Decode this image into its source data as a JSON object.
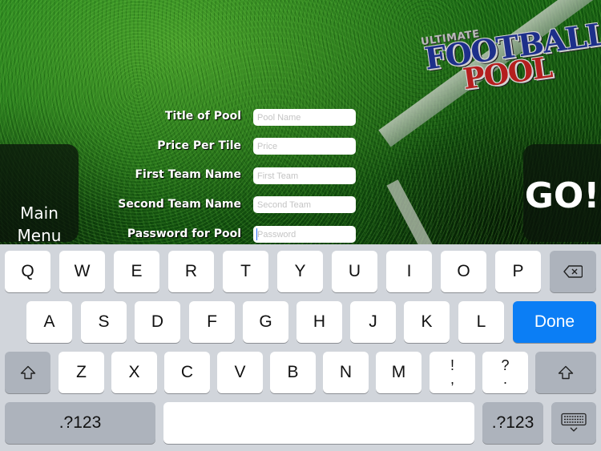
{
  "app": {
    "logo": {
      "line1": "ULTIMATE",
      "line2": "FOOTBALL",
      "line3": "POOL"
    },
    "main_menu_label": "Main\nMenu",
    "go_label": "GO!",
    "form": [
      {
        "label": "Title of Pool",
        "placeholder": "Pool Name",
        "value": ""
      },
      {
        "label": "Price Per Tile",
        "placeholder": "Price",
        "value": ""
      },
      {
        "label": "First Team Name",
        "placeholder": "First Team",
        "value": ""
      },
      {
        "label": "Second Team Name",
        "placeholder": "Second Team",
        "value": ""
      },
      {
        "label": "Password for Pool",
        "placeholder": "Password",
        "value": ""
      }
    ]
  },
  "keyboard": {
    "row1": [
      "Q",
      "W",
      "E",
      "R",
      "T",
      "Y",
      "U",
      "I",
      "O",
      "P"
    ],
    "row2": [
      "A",
      "S",
      "D",
      "F",
      "G",
      "H",
      "J",
      "K",
      "L"
    ],
    "row3": [
      "Z",
      "X",
      "C",
      "V",
      "B",
      "N",
      "M"
    ],
    "punct1": "!\n,",
    "punct2": "?\n.",
    "done_label": "Done",
    "numbers_label": ".?123",
    "backspace_icon": "backspace-icon",
    "shift_icon": "shift-icon",
    "hide_keyboard_icon": "keyboard-hide-icon",
    "accent_color": "#0b7ef5"
  }
}
